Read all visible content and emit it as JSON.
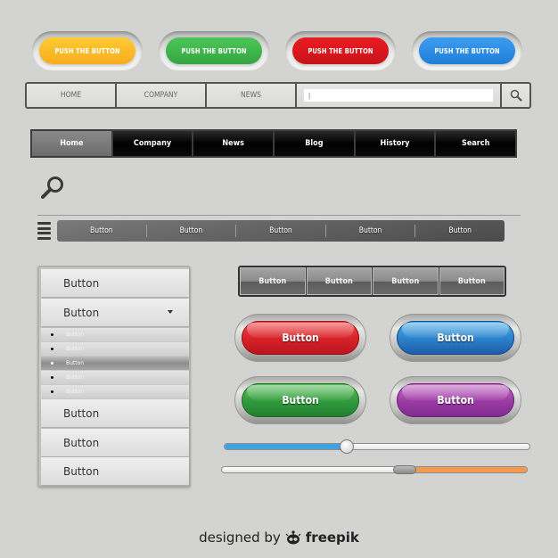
{
  "push_buttons": [
    {
      "label": "PUSH THE BUTTON",
      "color": "#fbb829"
    },
    {
      "label": "PUSH THE BUTTON",
      "color": "#40b84c"
    },
    {
      "label": "PUSH THE BUTTON",
      "color": "#d7141b"
    },
    {
      "label": "PUSH THE BUTTON",
      "color": "#2f8fe6"
    }
  ],
  "light_nav": {
    "items": [
      "HOME",
      "COMPANY",
      "NEWS"
    ],
    "search": {
      "value": "",
      "placeholder": "|",
      "icon": "search-icon"
    }
  },
  "dark_nav": {
    "items": [
      "Home",
      "Company",
      "News",
      "Blog",
      "History",
      "Search"
    ],
    "active_index": 0
  },
  "standalone_icon": "search-icon",
  "grey_bar": {
    "menu_icon": "hamburger-icon",
    "items": [
      "Button",
      "Button",
      "Button",
      "Button",
      "Button"
    ]
  },
  "vertical_menu": {
    "top_items": [
      "Button",
      "Button"
    ],
    "dropdown_icon": "caret-down-icon",
    "sub_items": [
      "Button",
      "Button",
      "Button",
      "Button",
      "Button"
    ],
    "active_sub_index": 2,
    "bottom_items": [
      "Button",
      "Button",
      "Button"
    ]
  },
  "segmented_bar": {
    "items": [
      "Button",
      "Button",
      "Button",
      "Button"
    ]
  },
  "glossy_buttons": [
    {
      "label": "Button",
      "color": "red"
    },
    {
      "label": "Button",
      "color": "blue"
    },
    {
      "label": "Button",
      "color": "green"
    },
    {
      "label": "Button",
      "color": "purple"
    }
  ],
  "sliders": [
    {
      "value_percent": 40,
      "fill_color": "#3fa3e0",
      "fill_side": "left"
    },
    {
      "value_percent": 60,
      "fill_color": "#f09a52",
      "fill_side": "right"
    }
  ],
  "footer": {
    "prefix": "designed by",
    "brand": "freepik",
    "logo_icon": "freepik-logo-icon"
  }
}
